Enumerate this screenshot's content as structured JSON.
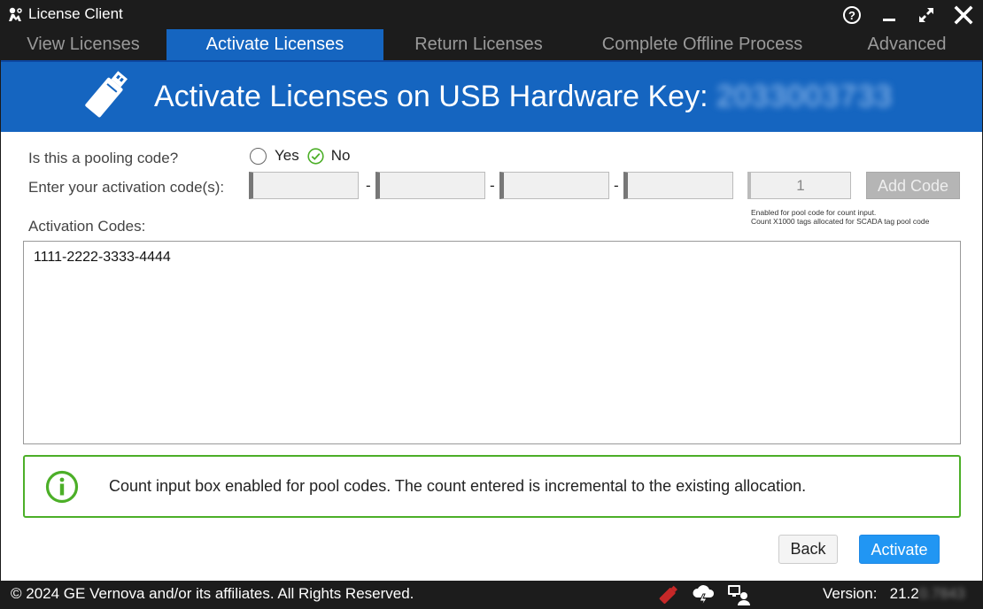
{
  "window": {
    "title": "License Client",
    "help_icon": "help-icon",
    "minimize_icon": "minimize-icon",
    "maximize_icon": "maximize-icon",
    "close_icon": "close-icon"
  },
  "tabs": [
    {
      "label": "View Licenses",
      "active": false
    },
    {
      "label": "Activate Licenses",
      "active": true
    },
    {
      "label": "Return Licenses",
      "active": false
    },
    {
      "label": "Complete Offline Process",
      "active": false
    },
    {
      "label": "Advanced",
      "active": false
    }
  ],
  "banner": {
    "title": "Activate Licenses on USB Hardware Key:",
    "key_id": "2033003733",
    "icon": "usb-key-icon"
  },
  "form": {
    "pooling_label": "Is this a pooling code?",
    "yes_label": "Yes",
    "no_label": "No",
    "selected": "No",
    "activation_label": "Enter your activation code(s):",
    "code_segments": [
      "",
      "",
      "",
      ""
    ],
    "separator": "-",
    "count_value": "1",
    "add_code_label": "Add Code",
    "hint_line1": "Enabled for pool code for count input.",
    "hint_line2": "Count X1000 tags allocated for SCADA tag pool code",
    "codes_label": "Activation Codes:",
    "codes_list": "1111-2222-3333-4444"
  },
  "info": {
    "icon": "info-icon",
    "message": "Count input box enabled for pool codes. The count entered is incremental to the existing allocation."
  },
  "actions": {
    "back_label": "Back",
    "activate_label": "Activate"
  },
  "footer": {
    "copyright": "© 2024 GE Vernova and/or its affiliates.  All Rights Reserved.",
    "version_label": "Version:",
    "version_value": "21.2",
    "version_hidden": "0.7843",
    "status_icons": [
      "usb-key-status-icon",
      "cloud-lightning-icon",
      "remote-desktop-icon"
    ]
  },
  "colors": {
    "accent": "#1565c0",
    "titlebar": "#1c1c1c",
    "info_border": "#4caf28",
    "primary_button": "#2196f3"
  }
}
